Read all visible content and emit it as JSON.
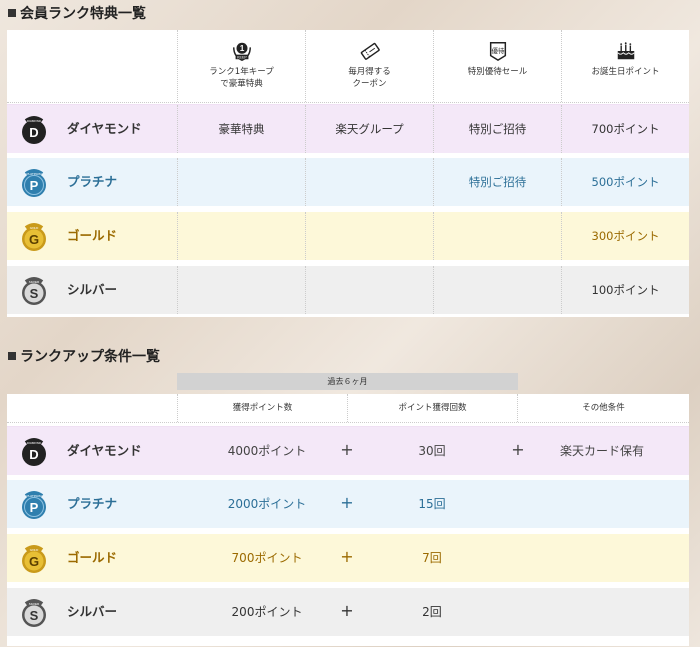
{
  "sections": {
    "benefits_title": "会員ランク特典一覧",
    "rankup_title": "ランクアップ条件一覧"
  },
  "benefits": {
    "columns": [
      {
        "label": "ランク1年キープ\nで豪華特典",
        "icon": "keep-icon",
        "icon_text_top": "1",
        "icon_text_bottom": "KEEP"
      },
      {
        "label": "毎月得する\nクーポン",
        "icon": "coupon-icon"
      },
      {
        "label": "特別優待セール",
        "icon": "sale-icon",
        "icon_text": "優待"
      },
      {
        "label": "お誕生日ポイント",
        "icon": "cake-icon"
      }
    ],
    "rows": [
      {
        "rank": "ダイヤモンド",
        "medal": "DIAMOND",
        "letter": "D",
        "cells": [
          "豪華特典",
          "楽天グループ",
          "特別ご招待",
          "700ポイント"
        ]
      },
      {
        "rank": "プラチナ",
        "medal": "PLATINUM",
        "letter": "P",
        "cells": [
          "",
          "",
          "特別ご招待",
          "500ポイント"
        ]
      },
      {
        "rank": "ゴールド",
        "medal": "GOLD",
        "letter": "G",
        "cells": [
          "",
          "",
          "",
          "300ポイント"
        ]
      },
      {
        "rank": "シルバー",
        "medal": "SILVER",
        "letter": "S",
        "cells": [
          "",
          "",
          "",
          "100ポイント"
        ]
      }
    ]
  },
  "rankup": {
    "period_label": "過去６ヶ月",
    "columns": [
      "獲得ポイント数",
      "ポイント獲得回数",
      "その他条件"
    ],
    "plus": "+",
    "rows": [
      {
        "rank": "ダイヤモンド",
        "medal": "DIAMOND",
        "letter": "D",
        "points": "4000ポイント",
        "count": "30回",
        "other": "楽天カード保有"
      },
      {
        "rank": "プラチナ",
        "medal": "PLATINUM",
        "letter": "P",
        "points": "2000ポイント",
        "count": "15回",
        "other": ""
      },
      {
        "rank": "ゴールド",
        "medal": "GOLD",
        "letter": "G",
        "points": "700ポイント",
        "count": "7回",
        "other": ""
      },
      {
        "rank": "シルバー",
        "medal": "SILVER",
        "letter": "S",
        "points": "200ポイント",
        "count": "2回",
        "other": ""
      }
    ]
  },
  "colors": {
    "diamond_bg": "#f4e8f8",
    "platinum_bg": "#eaf4fb",
    "gold_bg": "#fdf8d9",
    "silver_bg": "#efefef",
    "platinum_text": "#2c6f97",
    "gold_text": "#9b6a00"
  }
}
